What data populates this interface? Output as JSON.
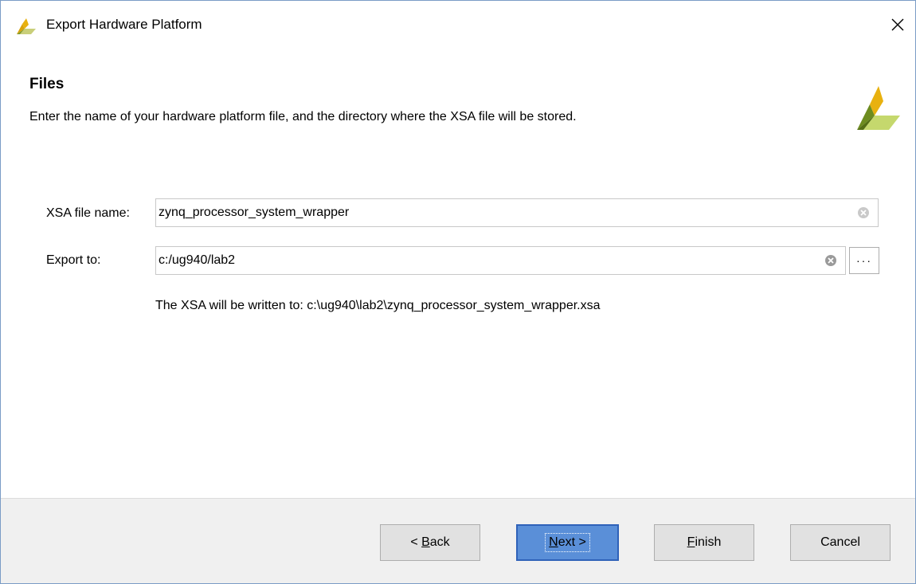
{
  "window": {
    "title": "Export Hardware Platform"
  },
  "header": {
    "title": "Files",
    "description": "Enter the name of your hardware platform file, and the directory where the XSA file will be stored."
  },
  "form": {
    "xsa_label": "XSA file name:",
    "xsa_value": "zynq_processor_system_wrapper",
    "export_label": "Export to:",
    "export_value": "c:/ug940/lab2",
    "browse_label": "···",
    "output_note": "The XSA will be written to: c:\\ug940\\lab2\\zynq_processor_system_wrapper.xsa"
  },
  "buttons": {
    "back_prefix": "< ",
    "back_mnemonic": "B",
    "back_rest": "ack",
    "next_mnemonic": "N",
    "next_rest": "ext >",
    "finish_mnemonic": "F",
    "finish_rest": "inish",
    "cancel": "Cancel"
  },
  "icons": {
    "app_logo": "xilinx-logo-icon",
    "close": "close-icon",
    "clear": "clear-icon"
  },
  "colors": {
    "logo_yellow": "#e8b10f",
    "logo_green": "#6d8c1f",
    "logo_light": "#c5d86d",
    "primary_button": "#5a8fd8",
    "primary_border": "#2f62b9"
  }
}
